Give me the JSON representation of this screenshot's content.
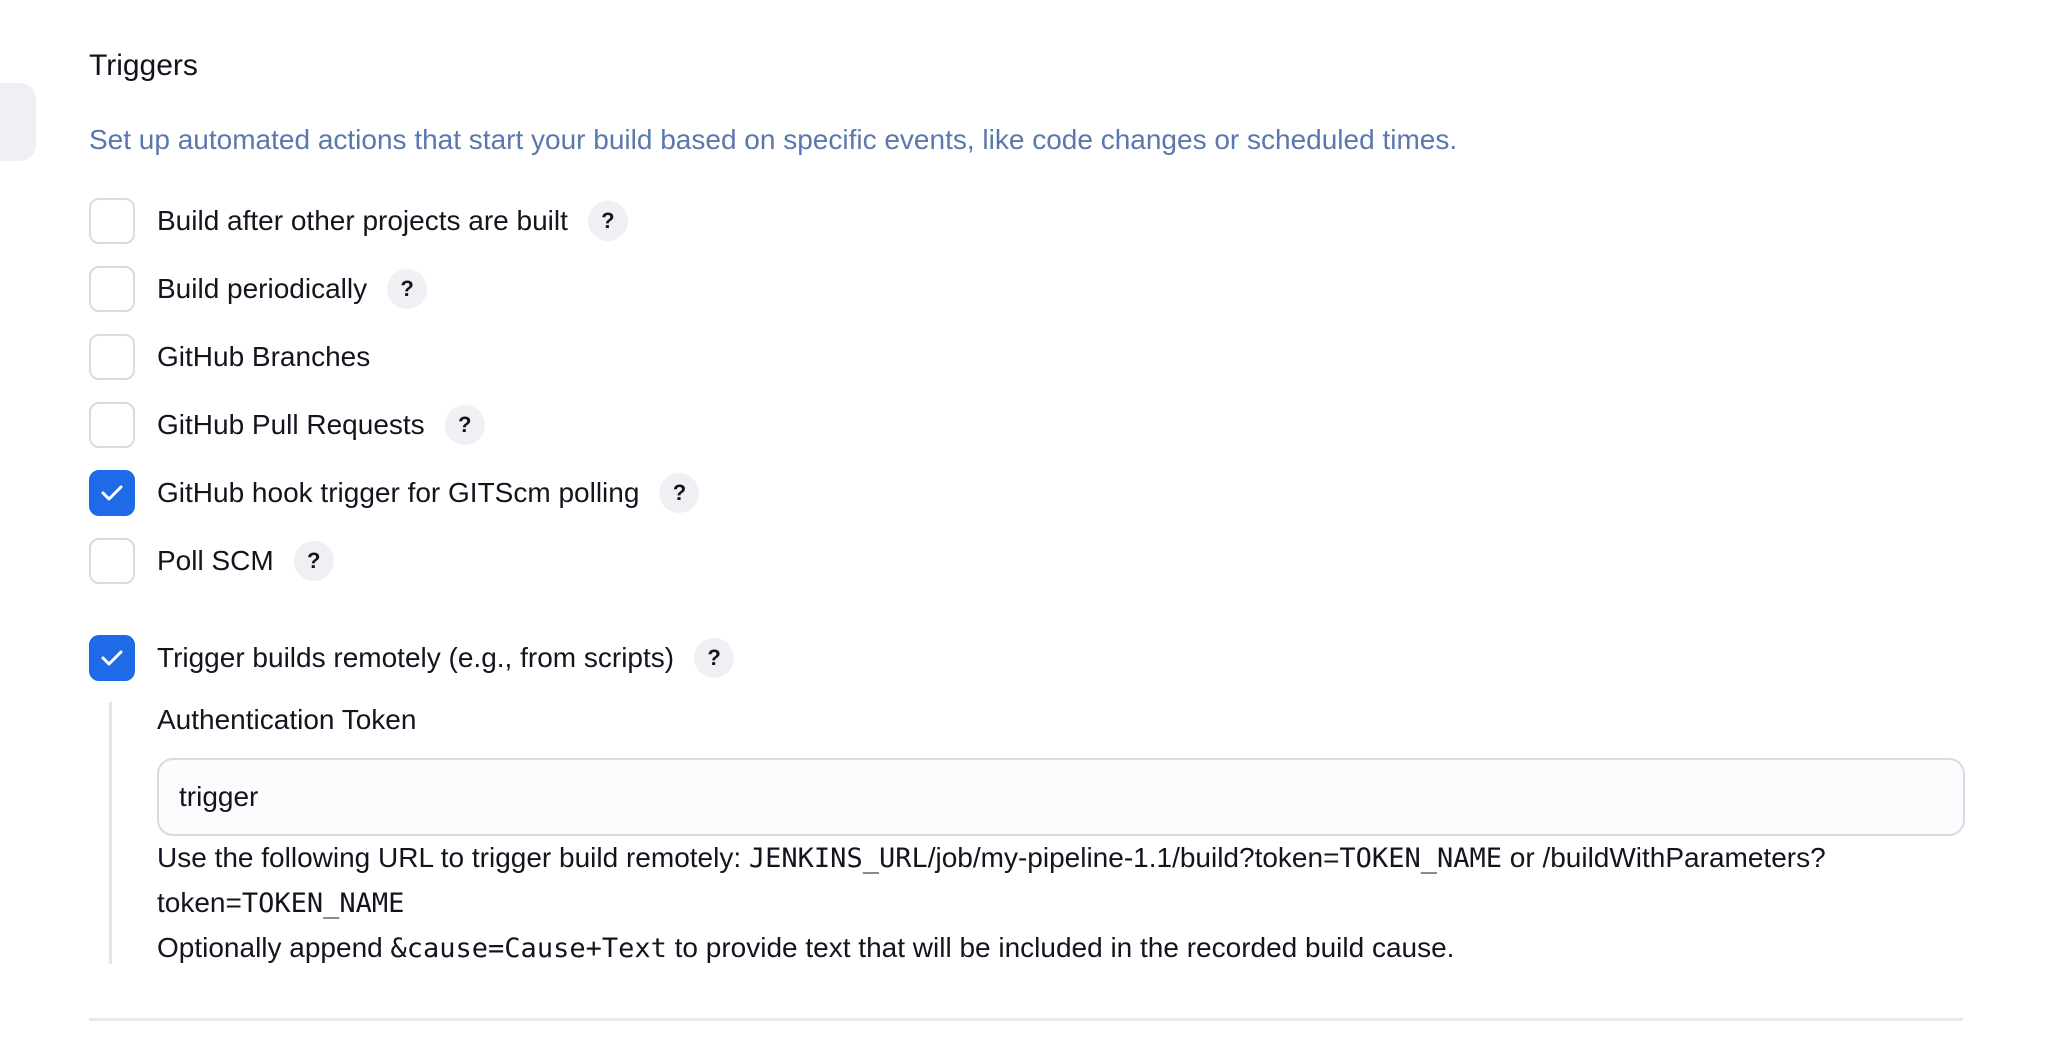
{
  "section": {
    "title": "Triggers",
    "description": "Set up automated actions that start your build based on specific events, like code changes or scheduled times."
  },
  "options": [
    {
      "label": "Build after other projects are built",
      "checked": false,
      "help": "?"
    },
    {
      "label": "Build periodically",
      "checked": false,
      "help": "?"
    },
    {
      "label": "GitHub Branches",
      "checked": false
    },
    {
      "label": "GitHub Pull Requests",
      "checked": false,
      "help": "?"
    },
    {
      "label": "GitHub hook trigger for GITScm polling",
      "checked": true,
      "help": "?"
    },
    {
      "label": "Poll SCM",
      "checked": false,
      "help": "?"
    },
    {
      "label": "Trigger builds remotely (e.g., from scripts)",
      "checked": true,
      "help": "?"
    }
  ],
  "remote": {
    "token_label": "Authentication Token",
    "token_value": "trigger",
    "help_prefix": "Use the following URL to trigger build remotely: ",
    "help_url_mono_start": "JENKINS_URL",
    "help_url_path": "/job/my-pipeline-1.1/build?token=",
    "help_token_name_1": "TOKEN_NAME",
    "help_or": " or /buildWithParameters?",
    "help_token_prefix": "token=",
    "help_token_name_2": "TOKEN_NAME",
    "append_prefix": "Optionally append ",
    "append_code": "&cause=Cause+Text",
    "append_suffix": " to provide text that will be included in the recorded build cause."
  },
  "colors": {
    "accent": "#1f6ae6",
    "description": "#5a78ad"
  },
  "icons": {
    "check": "check-icon",
    "help": "help-icon"
  }
}
